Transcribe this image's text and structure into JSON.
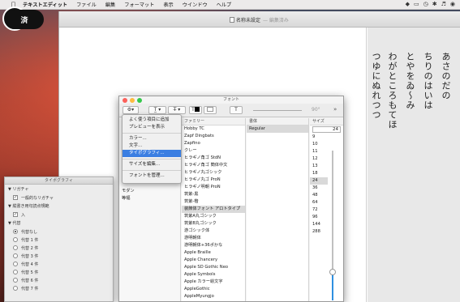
{
  "menubar": {
    "app_name": "テキストエディット",
    "items": [
      "ファイル",
      "編集",
      "フォーマット",
      "表示",
      "ウインドウ",
      "ヘルプ"
    ],
    "status_icons": [
      "dropbox-icon",
      "display-icon",
      "time-machine-icon",
      "bluetooth-icon",
      "volume-icon",
      "wifi-icon"
    ]
  },
  "badge": {
    "text": "済"
  },
  "document": {
    "title": "名称未設定",
    "edited_label": "— 編集済み",
    "vertical_lines": [
      "あさのだの",
      "ちりのはいは",
      "とやをゐ〜み",
      "わがところもてほ",
      "つゆにぬれつつ"
    ]
  },
  "typography_panel": {
    "title": "タイポグラフィ",
    "sections": [
      {
        "header": "リガチャ",
        "options": [
          {
            "label": "一般的なリガチャ",
            "kind": "checkbox",
            "checked": true
          }
        ]
      },
      {
        "header": "縦書き用句読点規範",
        "options": [
          {
            "label": "入",
            "kind": "checkbox",
            "checked": true
          }
        ]
      },
      {
        "header": "代替",
        "options": [
          {
            "label": "代替なし",
            "kind": "radio",
            "checked": true
          },
          {
            "label": "代替 1 件",
            "kind": "radio",
            "checked": false
          },
          {
            "label": "代替 2 件",
            "kind": "radio",
            "checked": false
          },
          {
            "label": "代替 3 件",
            "kind": "radio",
            "checked": false
          },
          {
            "label": "代替 4 件",
            "kind": "radio",
            "checked": false
          },
          {
            "label": "代替 5 件",
            "kind": "radio",
            "checked": false
          },
          {
            "label": "代替 6 件",
            "kind": "radio",
            "checked": false
          },
          {
            "label": "代替 7 件",
            "kind": "radio",
            "checked": false
          }
        ]
      }
    ]
  },
  "font_window": {
    "title": "フォント",
    "rotation": "90°",
    "collections": [
      "モダン",
      "等幅"
    ],
    "family_header": "ファミリー",
    "families": [
      "Hobby TC",
      "Zapf Dingbats",
      "Zapfino",
      "クレー",
      "ヒラギノ角ゴ StdN",
      "ヒラギノ角ゴ 簡体中文",
      "ヒラギノ丸ゴシック",
      "ヒラギノ丸ゴ ProN",
      "ヒラギノ明朝 ProN",
      "筑紫-黒",
      "筑紫-楷",
      "筑紫A丸ゴシック",
      "筑紫B丸ゴシック",
      "游ゴシック体",
      "游明朝体",
      "游明朝体+36ポかな",
      "Apple Braille",
      "Apple Chancery",
      "Apple SD Gothic Neo",
      "Apple Symbols",
      "Apple カラー絵文字",
      "AppleGothic",
      "AppleMyungjo"
    ],
    "families_selected": "装飾体フォント アロトタイプ",
    "style_header": "書体",
    "styles": [
      "Regular"
    ],
    "size_header": "サイズ",
    "size_value": "24",
    "sizes": [
      "9",
      "10",
      "11",
      "12",
      "13",
      "18",
      "24",
      "36",
      "48",
      "64",
      "72",
      "96",
      "144",
      "288"
    ],
    "size_selected": "24"
  },
  "popup_menu": {
    "groups": [
      [
        "よく使う項目に追加",
        "プレビューを表示"
      ],
      [
        "カラー...",
        "文字...",
        "タイポグラフィ..."
      ],
      [
        "サイズを編集..."
      ],
      [
        "フォントを管理..."
      ]
    ],
    "highlighted": "タイポグラフィ..."
  },
  "colors": {
    "accent": "#3a7ee2",
    "slider_fill": "#2f8fe0"
  }
}
